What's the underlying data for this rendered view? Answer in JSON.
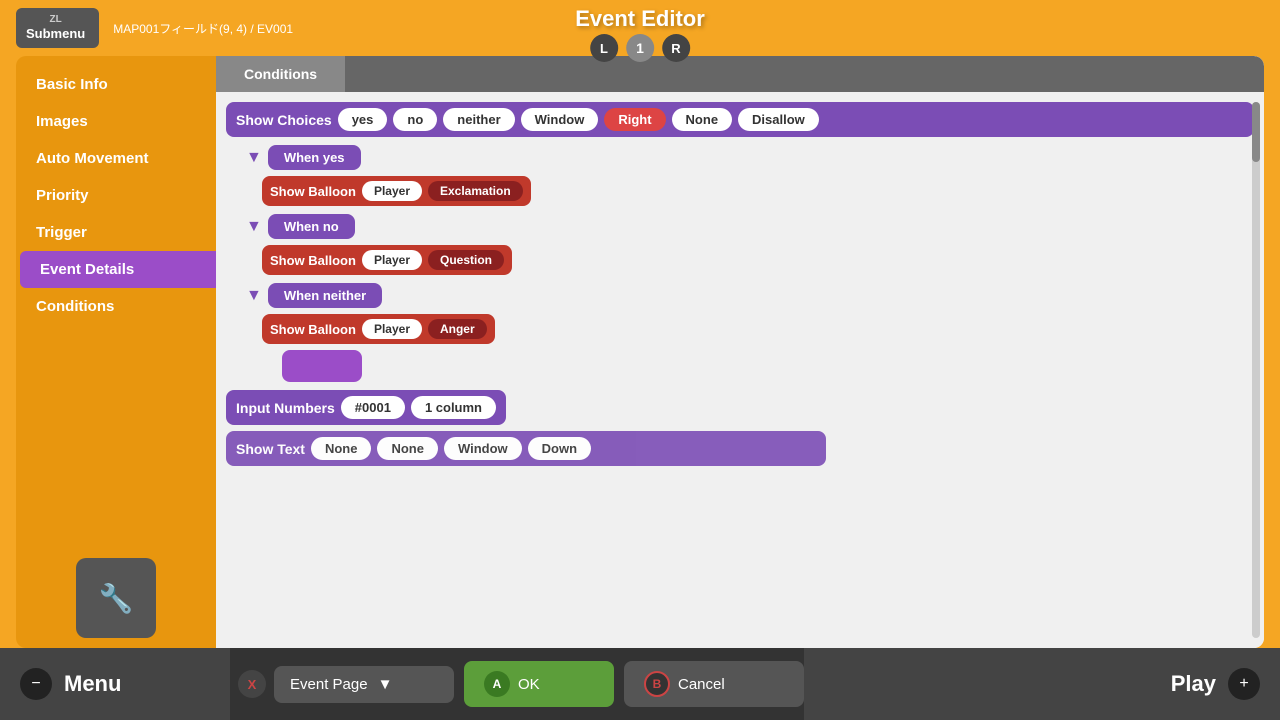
{
  "header": {
    "submenu_label": "Submenu",
    "zl_label": "ZL",
    "breadcrumb": "MAP001フィールド(9, 4) / EV001",
    "title": "Event Editor",
    "page_left": "L",
    "page_num": "1",
    "page_right": "R"
  },
  "sidebar": {
    "items": [
      {
        "label": "Basic Info"
      },
      {
        "label": "Images"
      },
      {
        "label": "Auto Movement"
      },
      {
        "label": "Priority"
      },
      {
        "label": "Trigger"
      },
      {
        "label": "Event Details"
      },
      {
        "label": "Conditions"
      }
    ],
    "active_index": 5,
    "add_icon": "➕"
  },
  "tabs": [
    {
      "label": "Conditions"
    }
  ],
  "event_editor": {
    "show_choices": {
      "label": "Show Choices",
      "options": [
        "yes",
        "no",
        "neither",
        "Window",
        "Right",
        "None",
        "Disallow"
      ]
    },
    "when_blocks": [
      {
        "label": "When yes",
        "action": {
          "label": "Show Balloon",
          "target": "Player",
          "type": "Exclamation"
        }
      },
      {
        "label": "When no",
        "action": {
          "label": "Show Balloon",
          "target": "Player",
          "type": "Question"
        }
      },
      {
        "label": "When neither",
        "action": {
          "label": "Show Balloon",
          "target": "Player",
          "type": "Anger"
        }
      }
    ],
    "input_numbers": {
      "label": "Input Numbers",
      "id": "#0001",
      "columns": "1 column"
    },
    "show_text": {
      "label": "Show Text",
      "opts": [
        "None",
        "None",
        "Window",
        "Down"
      ]
    }
  },
  "bottom_bar": {
    "menu_label": "Menu",
    "menu_minus": "−",
    "x_label": "X",
    "dropdown_label": "Event Page",
    "ok_label": "OK",
    "ok_btn": "A",
    "cancel_label": "Cancel",
    "cancel_btn": "B",
    "play_label": "Play",
    "play_plus": "+"
  }
}
